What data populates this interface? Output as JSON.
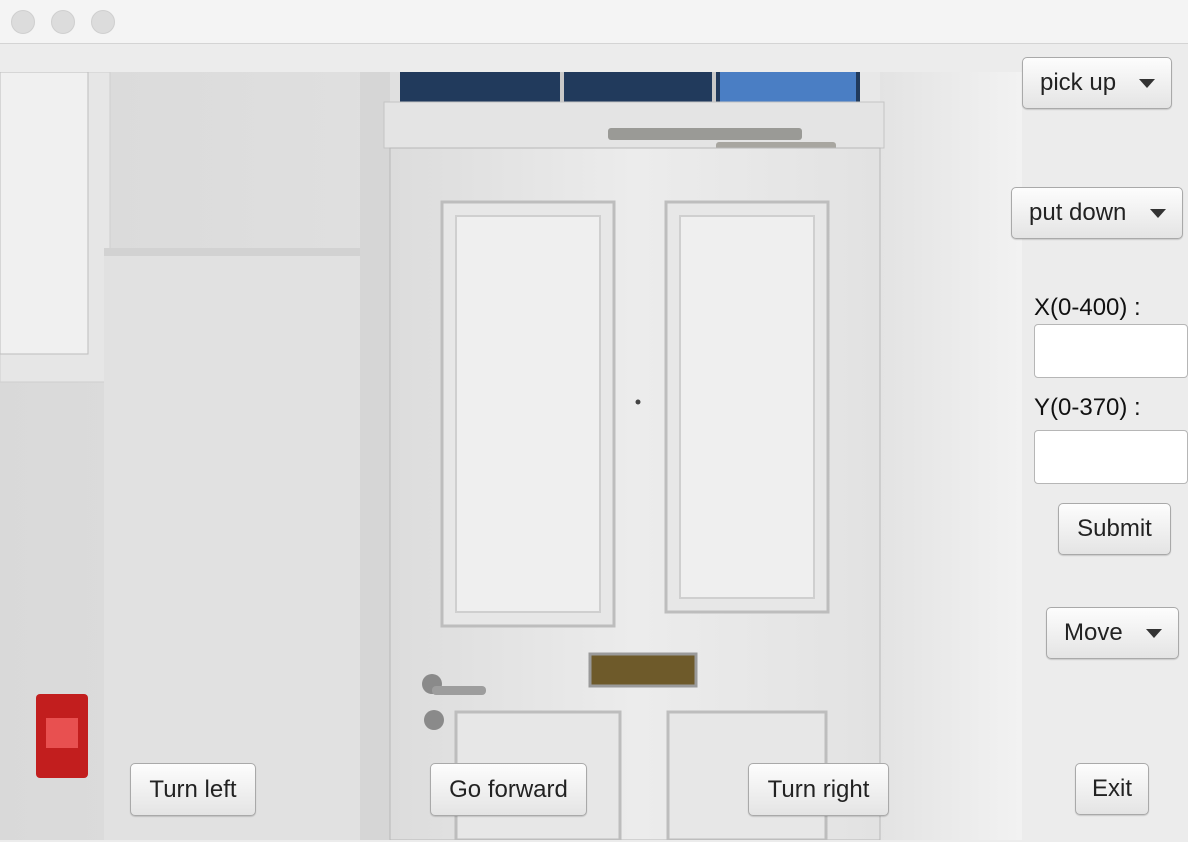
{
  "window": {
    "buttons": [
      "close",
      "minimize",
      "zoom"
    ]
  },
  "scene": {
    "description_icon": "room-door-photo"
  },
  "controls": {
    "pick_up": "pick up",
    "put_down": "put down",
    "x_label": "X(0-400) :",
    "x_value": "",
    "y_label": "Y(0-370) :",
    "y_value": "",
    "submit": "Submit",
    "move": "Move",
    "exit": "Exit"
  },
  "navigation": {
    "turn_left": "Turn left",
    "go_forward": "Go forward",
    "turn_right": "Turn right"
  }
}
